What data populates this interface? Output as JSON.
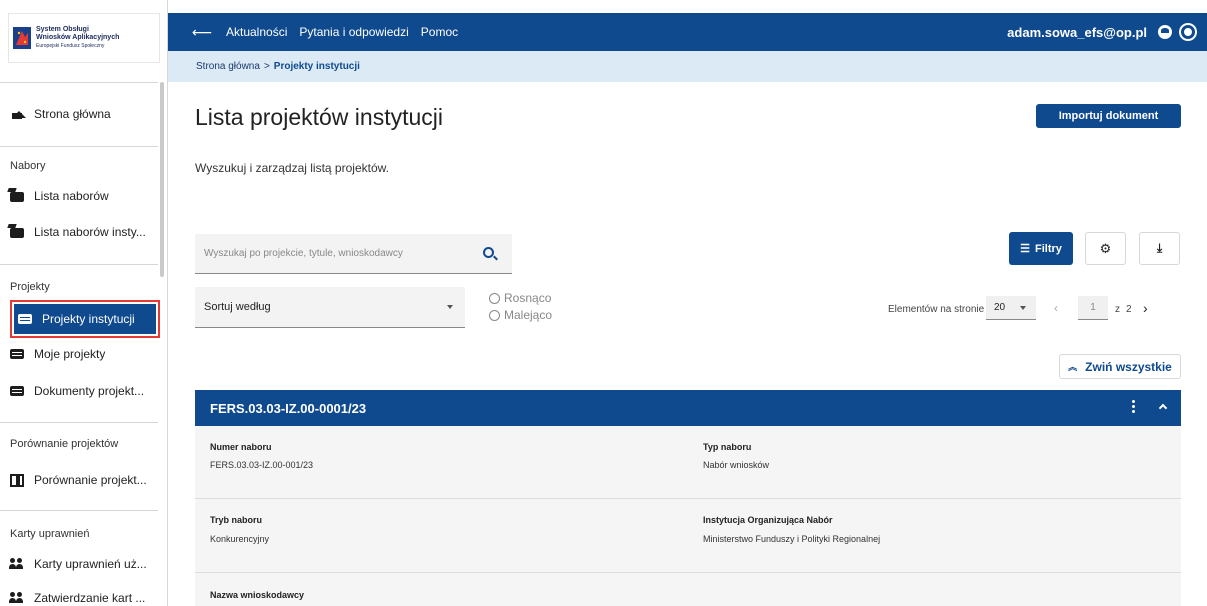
{
  "brand": {
    "line1": "System Obsługi",
    "line2": "Wniosków Aplikacyjnych",
    "line3": "Europejski Fundusz Społeczny"
  },
  "sidebar": {
    "home": "Strona główna",
    "sections": {
      "nabory": "Nabory",
      "projekty": "Projekty",
      "porownanie": "Porównanie projektów",
      "karty": "Karty uprawnień"
    },
    "items": {
      "lista_naborow": "Lista naborów",
      "lista_naborow_inst": "Lista naborów insty...",
      "projekty_instytucji": "Projekty instytucji",
      "moje_projekty": "Moje projekty",
      "dokumenty": "Dokumenty projekt...",
      "porownanie": "Porównanie projekt...",
      "karty_uzytk": "Karty uprawnień uż...",
      "zatwierdzanie": "Zatwierdzanie kart ..."
    }
  },
  "topbar": {
    "back_icon": "arrow-left-icon",
    "links": [
      "Aktualności",
      "Pytania i odpowiedzi",
      "Pomoc"
    ],
    "user": "adam.sowa_efs@op.pl"
  },
  "breadcrumb": {
    "home": "Strona główna",
    "sep": ">",
    "current": "Projekty instytucji"
  },
  "page": {
    "title": "Lista projektów instytucji",
    "description": "Wyszukuj i zarządzaj listą projektów.",
    "import_button": "Importuj dokument",
    "filters_button": "Filtry"
  },
  "search": {
    "placeholder": "Wyszukaj po projekcie, tytule, wnioskodawcy"
  },
  "sort": {
    "label": "Sortuj według",
    "asc": "Rosnąco",
    "desc": "Malejąco"
  },
  "pagination": {
    "per_page_label": "Elementów na stronie",
    "per_page": "20",
    "page": "1",
    "of": "z",
    "total": "2"
  },
  "collapse_all": "Zwiń wszystkie",
  "card": {
    "title": "FERS.03.03-IZ.00-0001/23",
    "fields": {
      "numer_label": "Numer naboru",
      "numer_value": "FERS.03.03-IZ.00-001/23",
      "typ_label": "Typ naboru",
      "typ_value": "Nabór wniosków",
      "tryb_label": "Tryb naboru",
      "tryb_value": "Konkurencyjny",
      "instytucja_label": "Instytucja Organizująca Nabór",
      "instytucja_value": "Ministerstwo Funduszy i Polityki Regionalnej",
      "wnioskodawca_label": "Nazwa wnioskodawcy"
    }
  },
  "colors": {
    "primary": "#0f4a8f",
    "breadcrumb_bg": "#dceaf6",
    "highlight": "#e53935"
  }
}
